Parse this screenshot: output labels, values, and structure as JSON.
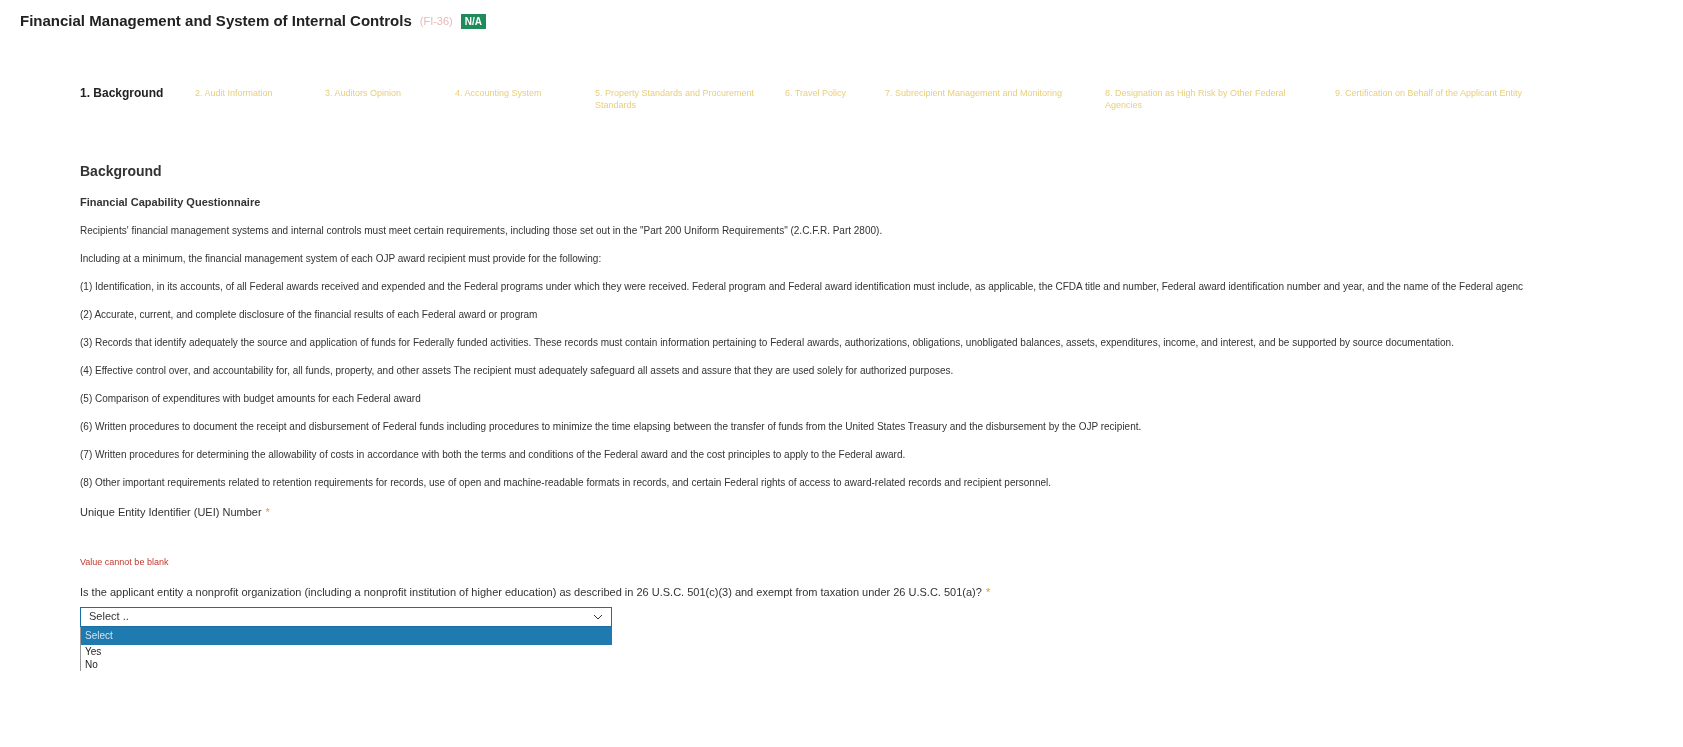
{
  "header": {
    "title": "Financial Management and System of Internal Controls",
    "code": "(FI-36)",
    "badge": "N/A"
  },
  "steps": [
    {
      "label": "1. Background",
      "selected": true
    },
    {
      "label": "2. Audit Information",
      "selected": false
    },
    {
      "label": "3. Auditors Opinion",
      "selected": false
    },
    {
      "label": "4. Accounting System",
      "selected": false
    },
    {
      "label": "5. Property Standards and Procurement Standards",
      "selected": false
    },
    {
      "label": "6. Travel Policy",
      "selected": false
    },
    {
      "label": "7. Subrecipient Management and Monitoring",
      "selected": false
    },
    {
      "label": "8. Designation as High Risk by Other Federal Agencies",
      "selected": false
    },
    {
      "label": "9. Certification on Behalf of the Applicant Entity",
      "selected": false
    }
  ],
  "section": {
    "title": "Background",
    "subtitle": "Financial Capability Questionnaire",
    "paragraphs": [
      "Recipients' financial management systems and internal controls must meet certain requirements, including those set out in the \"Part 200 Uniform Requirements\" (2.C.F.R. Part 2800).",
      "Including at a minimum, the financial management system of each OJP award recipient must provide for the following:",
      "(1)  Identification, in its accounts, of all Federal awards received and expended and the Federal programs under which they were received. Federal program and Federal award identification must include, as applicable, the   CFDA title and number, Federal award identification number and year, and the name of the Federal agenc",
      "(2) Accurate, current, and complete disclosure of the financial results of each Federal award or program",
      "(3) Records that identify adequately the source and application of funds for Federally funded activities. These records must contain information pertaining to Federal awards, authorizations, obligations, unobligated balances, assets, expenditures, income, and interest, and be supported by source documentation.",
      "(4) Effective control over, and accountability for, all funds, property, and other assets  The recipient must adequately safeguard all assets and assure that they are used solely for authorized purposes.",
      "(5) Comparison of expenditures with budget amounts for each Federal award",
      "(6) Written procedures to document the receipt and disbursement of Federal funds including procedures to minimize the time elapsing between the transfer of funds from the United States Treasury and the disbursement by the OJP recipient.",
      "(7) Written procedures for determining the allowability of costs in accordance with both the terms and conditions of the Federal award and the cost principles to apply to the Federal award.",
      "(8) Other important requirements related to retention requirements for records, use of open and machine-readable formats in records, and certain Federal rights of access to award-related records and recipient personnel."
    ]
  },
  "uei": {
    "label": "Unique Entity Identifier (UEI) Number",
    "required_mark": "*",
    "error": "Value cannot be blank"
  },
  "question": {
    "label": "Is the applicant entity a nonprofit organization (including a nonprofit institution of higher education) as described in 26 U.S.C. 501(c)(3) and exempt from taxation under 26 U.S.C. 501(a)?",
    "required_mark": "*",
    "value": "Select ..",
    "options": [
      {
        "label": "Select",
        "selected": true
      },
      {
        "label": "Yes",
        "selected": false
      },
      {
        "label": "No",
        "selected": false
      }
    ]
  }
}
